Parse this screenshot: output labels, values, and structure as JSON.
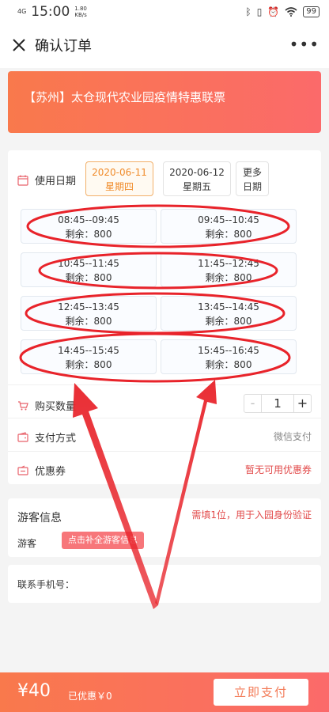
{
  "status_bar": {
    "network": "4G",
    "time": "15:00",
    "speed": "1.80",
    "speed_unit": "KB/s",
    "battery": "99"
  },
  "header": {
    "title": "确认订单",
    "more": "•••"
  },
  "banner": {
    "title": "【苏州】太仓现代农业园疫情特惠联票"
  },
  "date": {
    "label": "使用日期",
    "options": [
      {
        "date": "2020-06-11",
        "weekday": "星期四"
      },
      {
        "date": "2020-06-12",
        "weekday": "星期五"
      }
    ],
    "more_line1": "更多",
    "more_line2": "日期"
  },
  "slots": [
    {
      "time": "08:45--09:45",
      "rest": "剩余：800"
    },
    {
      "time": "09:45--10:45",
      "rest": "剩余：800"
    },
    {
      "time": "10:45--11:45",
      "rest": "剩余：800"
    },
    {
      "time": "11:45--12:45",
      "rest": "剩余：800"
    },
    {
      "time": "12:45--13:45",
      "rest": "剩余：800"
    },
    {
      "time": "13:45--14:45",
      "rest": "剩余：800"
    },
    {
      "time": "14:45--15:45",
      "rest": "剩余：800"
    },
    {
      "time": "15:45--16:45",
      "rest": "剩余：800"
    }
  ],
  "quantity": {
    "label": "购买数量",
    "minus": "-",
    "value": "1",
    "plus": "+"
  },
  "payment": {
    "label": "支付方式",
    "value": "微信支付"
  },
  "coupon": {
    "label": "优惠券",
    "value": "暂无可用优惠券"
  },
  "visitor": {
    "title": "游客信息",
    "note": "需填1位，用于入园身份验证",
    "label": "游客",
    "button": "点击补全游客信息"
  },
  "phone": {
    "label": "联系手机号："
  },
  "footer": {
    "price": "¥40",
    "discount": "已优惠￥0",
    "pay_button": "立即支付"
  },
  "colors": {
    "accent": "#fb6a6a",
    "annotation": "#e8232a",
    "active_date": "#f08b2a"
  }
}
